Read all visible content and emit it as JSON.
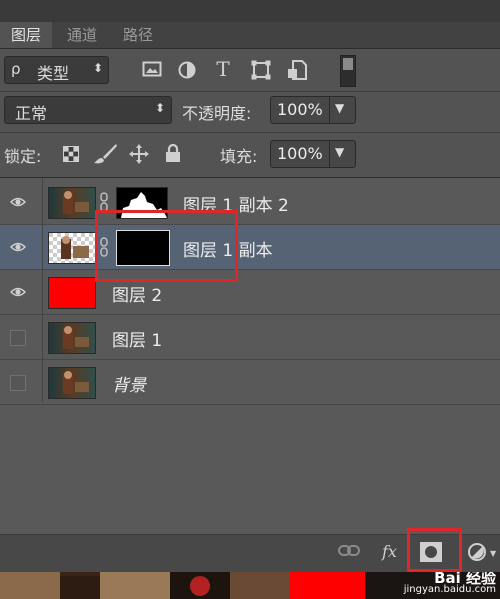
{
  "panel": {
    "tabs": [
      "图层",
      "通道",
      "路径"
    ]
  },
  "filter": {
    "search_symbol": "ρ",
    "kind_label": "类型",
    "icons": [
      "image-filter-icon",
      "adjustment-filter-icon",
      "text-filter-icon",
      "shape-filter-icon",
      "smart-object-filter-icon",
      "filter-toggle"
    ]
  },
  "blend": {
    "mode": "正常",
    "opacity_label": "不透明度:",
    "opacity_value": "100%"
  },
  "lock": {
    "label": "锁定:",
    "icons": [
      "lock-transparent-pixels-icon",
      "lock-image-pixels-icon",
      "lock-position-icon",
      "lock-all-icon"
    ],
    "fill_label": "填充:",
    "fill_value": "100%"
  },
  "layers": [
    {
      "name": "图层 1 副本 2",
      "visible": true,
      "selected": false,
      "thumb": "photo",
      "has_mask": true,
      "mask": "white-silhouette"
    },
    {
      "name": "图层 1 副本",
      "visible": true,
      "selected": true,
      "thumb": "photo-transparent",
      "has_mask": true,
      "mask": "black"
    },
    {
      "name": "图层 2",
      "visible": true,
      "selected": false,
      "thumb": "red-fill",
      "has_mask": false
    },
    {
      "name": "图层 1",
      "visible": false,
      "selected": false,
      "thumb": "photo",
      "has_mask": false
    },
    {
      "name": "背景",
      "visible": false,
      "selected": false,
      "thumb": "photo",
      "has_mask": false
    }
  ],
  "colors": {
    "selected_row": "#566375",
    "highlight_box": "#e0262b",
    "red_fill": "#ff0000"
  },
  "bottom_toolbar": {
    "fx_label": "fx",
    "icons": [
      "link-layers-icon",
      "layer-style-icon",
      "add-mask-icon",
      "adjustment-layer-icon"
    ]
  },
  "watermark": {
    "brand": "Bai 经验",
    "url": "jingyan.baidu.com"
  }
}
